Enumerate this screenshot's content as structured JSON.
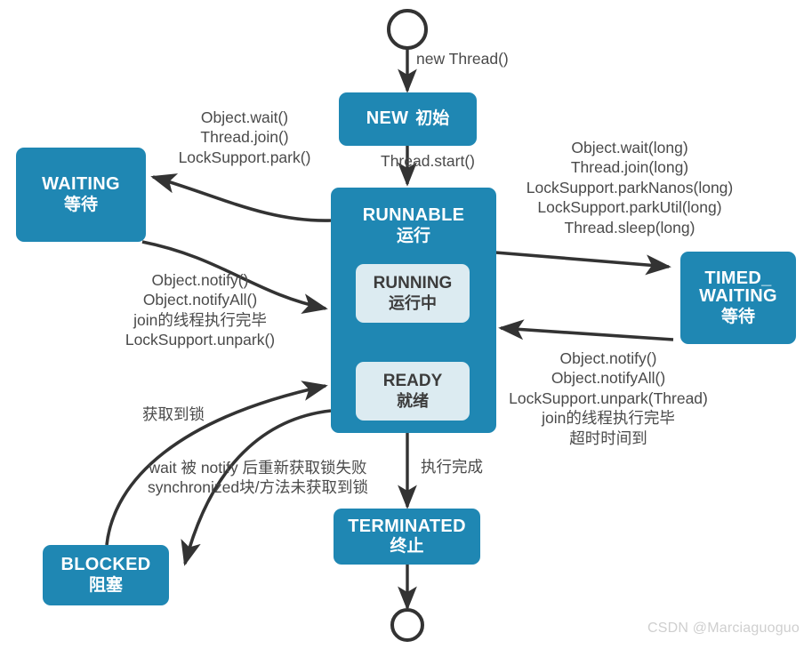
{
  "diagram": {
    "title": "Java Thread State Transition Diagram",
    "colors": {
      "state_fill": "#1f87b3",
      "inner_fill": "#dcebf1",
      "arrow_stroke": "#333333",
      "inner_arrow": "#f2ee62",
      "label_text": "#4a4a4a",
      "watermark": "#cfcfcf"
    },
    "watermark": "CSDN @Marciaguoguo",
    "states": {
      "start": {
        "name": "start-node"
      },
      "new": {
        "en": "NEW",
        "zh": "初始"
      },
      "runnable": {
        "en": "RUNNABLE",
        "zh": "运行"
      },
      "running": {
        "en": "RUNNING",
        "zh": "运行中"
      },
      "ready": {
        "en": "READY",
        "zh": "就绪"
      },
      "waiting": {
        "en": "WAITING",
        "zh": "等待"
      },
      "timed_waiting": {
        "en": "TIMED_WAITING",
        "en_line1": "TIMED_",
        "en_line2": "WAITING",
        "zh": "等待"
      },
      "blocked": {
        "en": "BLOCKED",
        "zh": "阻塞"
      },
      "terminated": {
        "en": "TERMINATED",
        "zh": "终止"
      },
      "end": {
        "name": "end-node"
      }
    },
    "labels": {
      "new_thread": "new Thread()",
      "thread_start": "Thread.start()",
      "to_waiting": "Object.wait()\nThread.join()\nLockSupport.park()",
      "from_waiting": "Object.notify()\nObject.notifyAll()\njoin的线程执行完毕\nLockSupport.unpark()",
      "to_timed_waiting": "Object.wait(long)\nThread.join(long)\nLockSupport.parkNanos(long)\nLockSupport.parkUtil(long)\nThread.sleep(long)",
      "from_timed_waiting": "Object.notify()\nObject.notifyAll()\nLockSupport.unpark(Thread)\njoin的线程执行完毕\n超时时间到",
      "acquired_lock": "获取到锁",
      "to_blocked": "wait 被 notify 后重新获取锁失败\nsynchronized块/方法未获取到锁",
      "execution_done": "执行完成"
    }
  }
}
